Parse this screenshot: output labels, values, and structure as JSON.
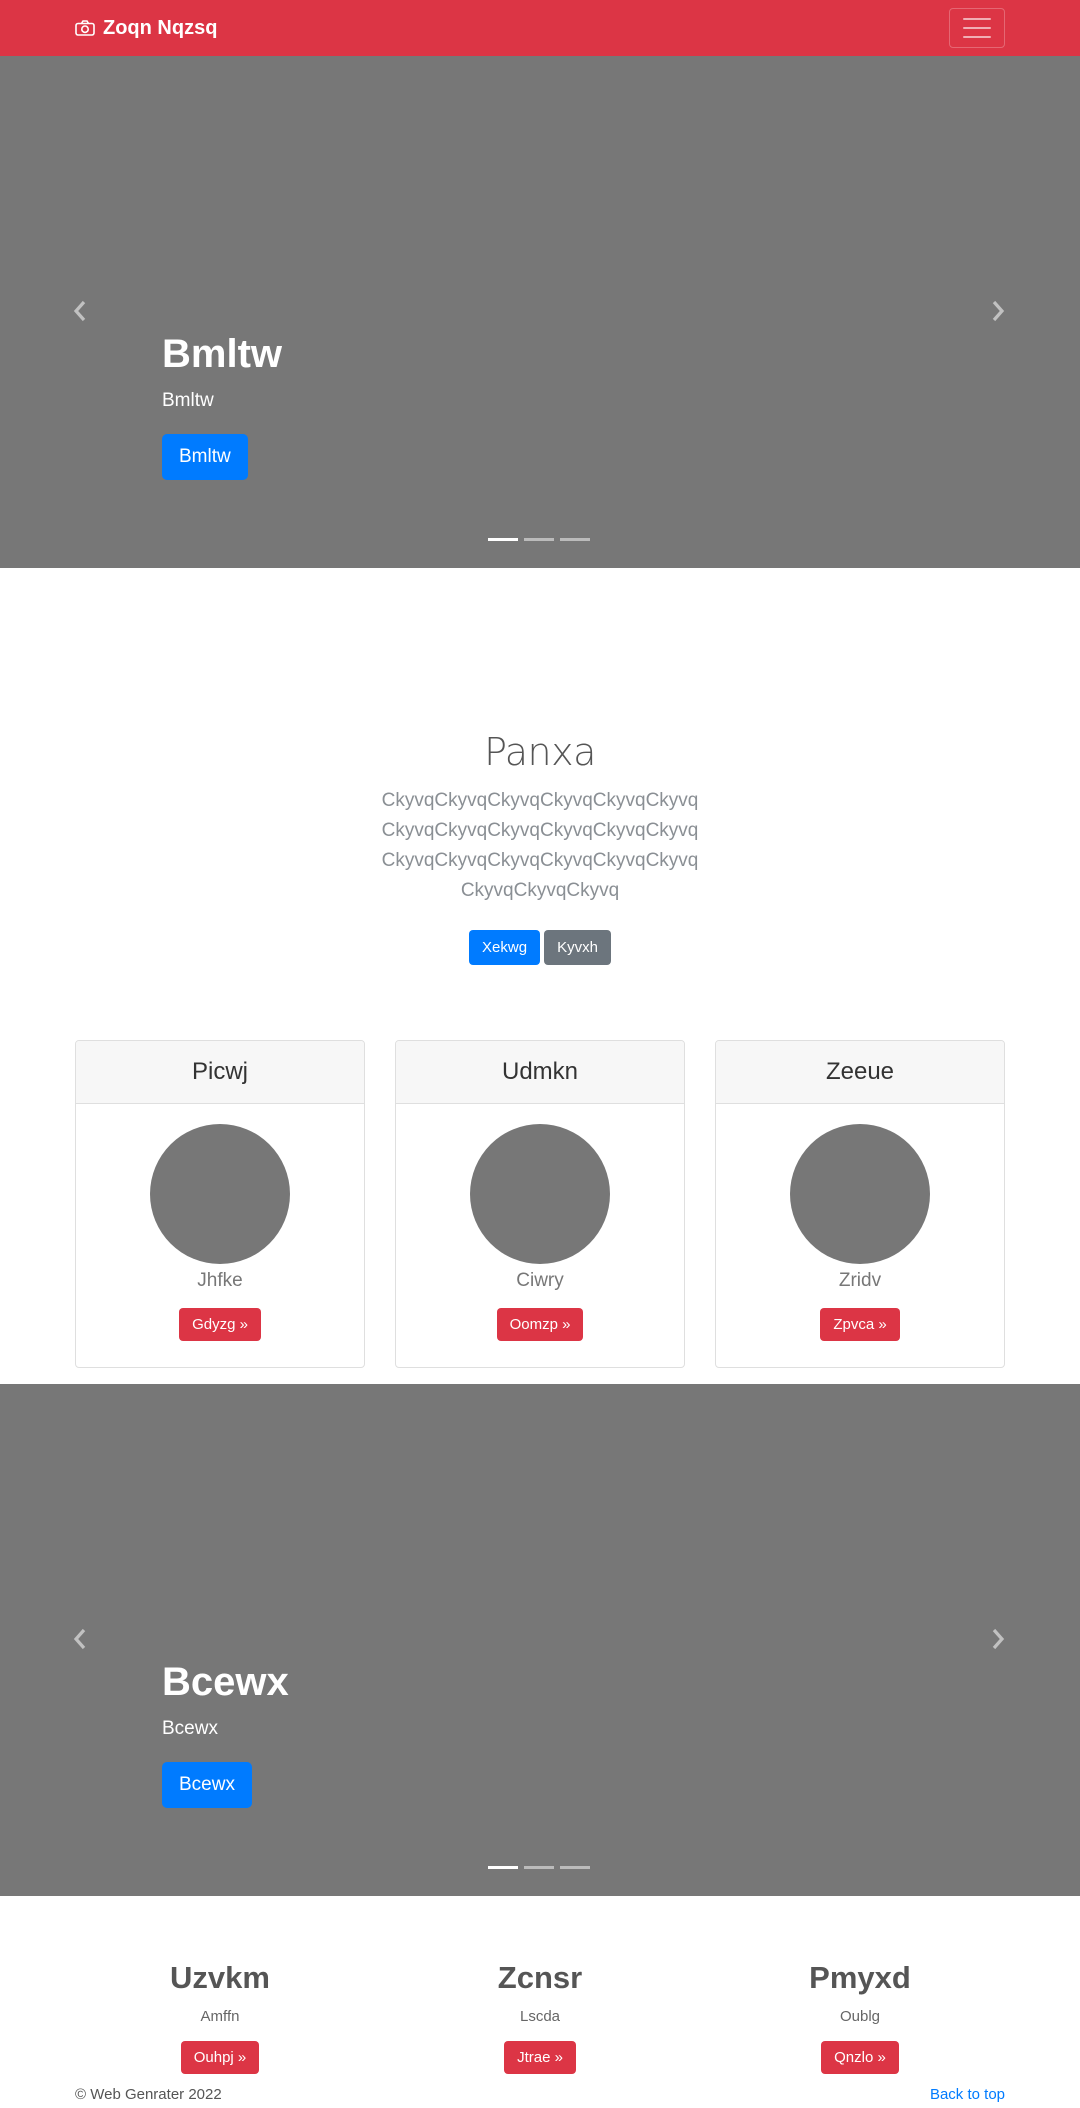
{
  "navbar": {
    "brand": "Zoqn Nqzsq",
    "brand_icon": "camera-icon",
    "toggler_icon": "hamburger-icon",
    "color": "#dc3545"
  },
  "carousel1": {
    "title": "Bmltw",
    "subtitle": "Bmltw",
    "button": "Bmltw",
    "prev_icon": "chevron-left-icon",
    "next_icon": "chevron-right-icon",
    "slides": 3,
    "active_slide": 1
  },
  "jumbotron": {
    "title": "Panxa",
    "lead": "CkyvqCkyvqCkyvqCkyvqCkyvqCkyvqCkyvqCkyvqCkyvqCkyvqCkyvqCkyvqCkyvqCkyvqCkyvqCkyvqCkyvqCkyvqCkyvqCkyvqCkyvq",
    "primary_button": "Xekwg",
    "secondary_button": "Kyvxh"
  },
  "cards": [
    {
      "header": "Picwj",
      "name": "Jhfke",
      "button": "Gdyzg »"
    },
    {
      "header": "Udmkn",
      "name": "Ciwry",
      "button": "Oomzp »"
    },
    {
      "header": "Zeeue",
      "name": "Zridv",
      "button": "Zpvca »"
    }
  ],
  "carousel2": {
    "title": "Bcewx",
    "subtitle": "Bcewx",
    "button": "Bcewx",
    "prev_icon": "chevron-left-icon",
    "next_icon": "chevron-right-icon",
    "slides": 3,
    "active_slide": 1
  },
  "columns": [
    {
      "title": "Uzvkm",
      "text": "Amffn",
      "button": "Ouhpj »"
    },
    {
      "title": "Zcnsr",
      "text": "Lscda",
      "button": "Jtrae »"
    },
    {
      "title": "Pmyxd",
      "text": "Oublg",
      "button": "Qnzlo »"
    }
  ],
  "footer": {
    "copyright": "© Web Genrater 2022",
    "back_to_top": "Back to top"
  }
}
